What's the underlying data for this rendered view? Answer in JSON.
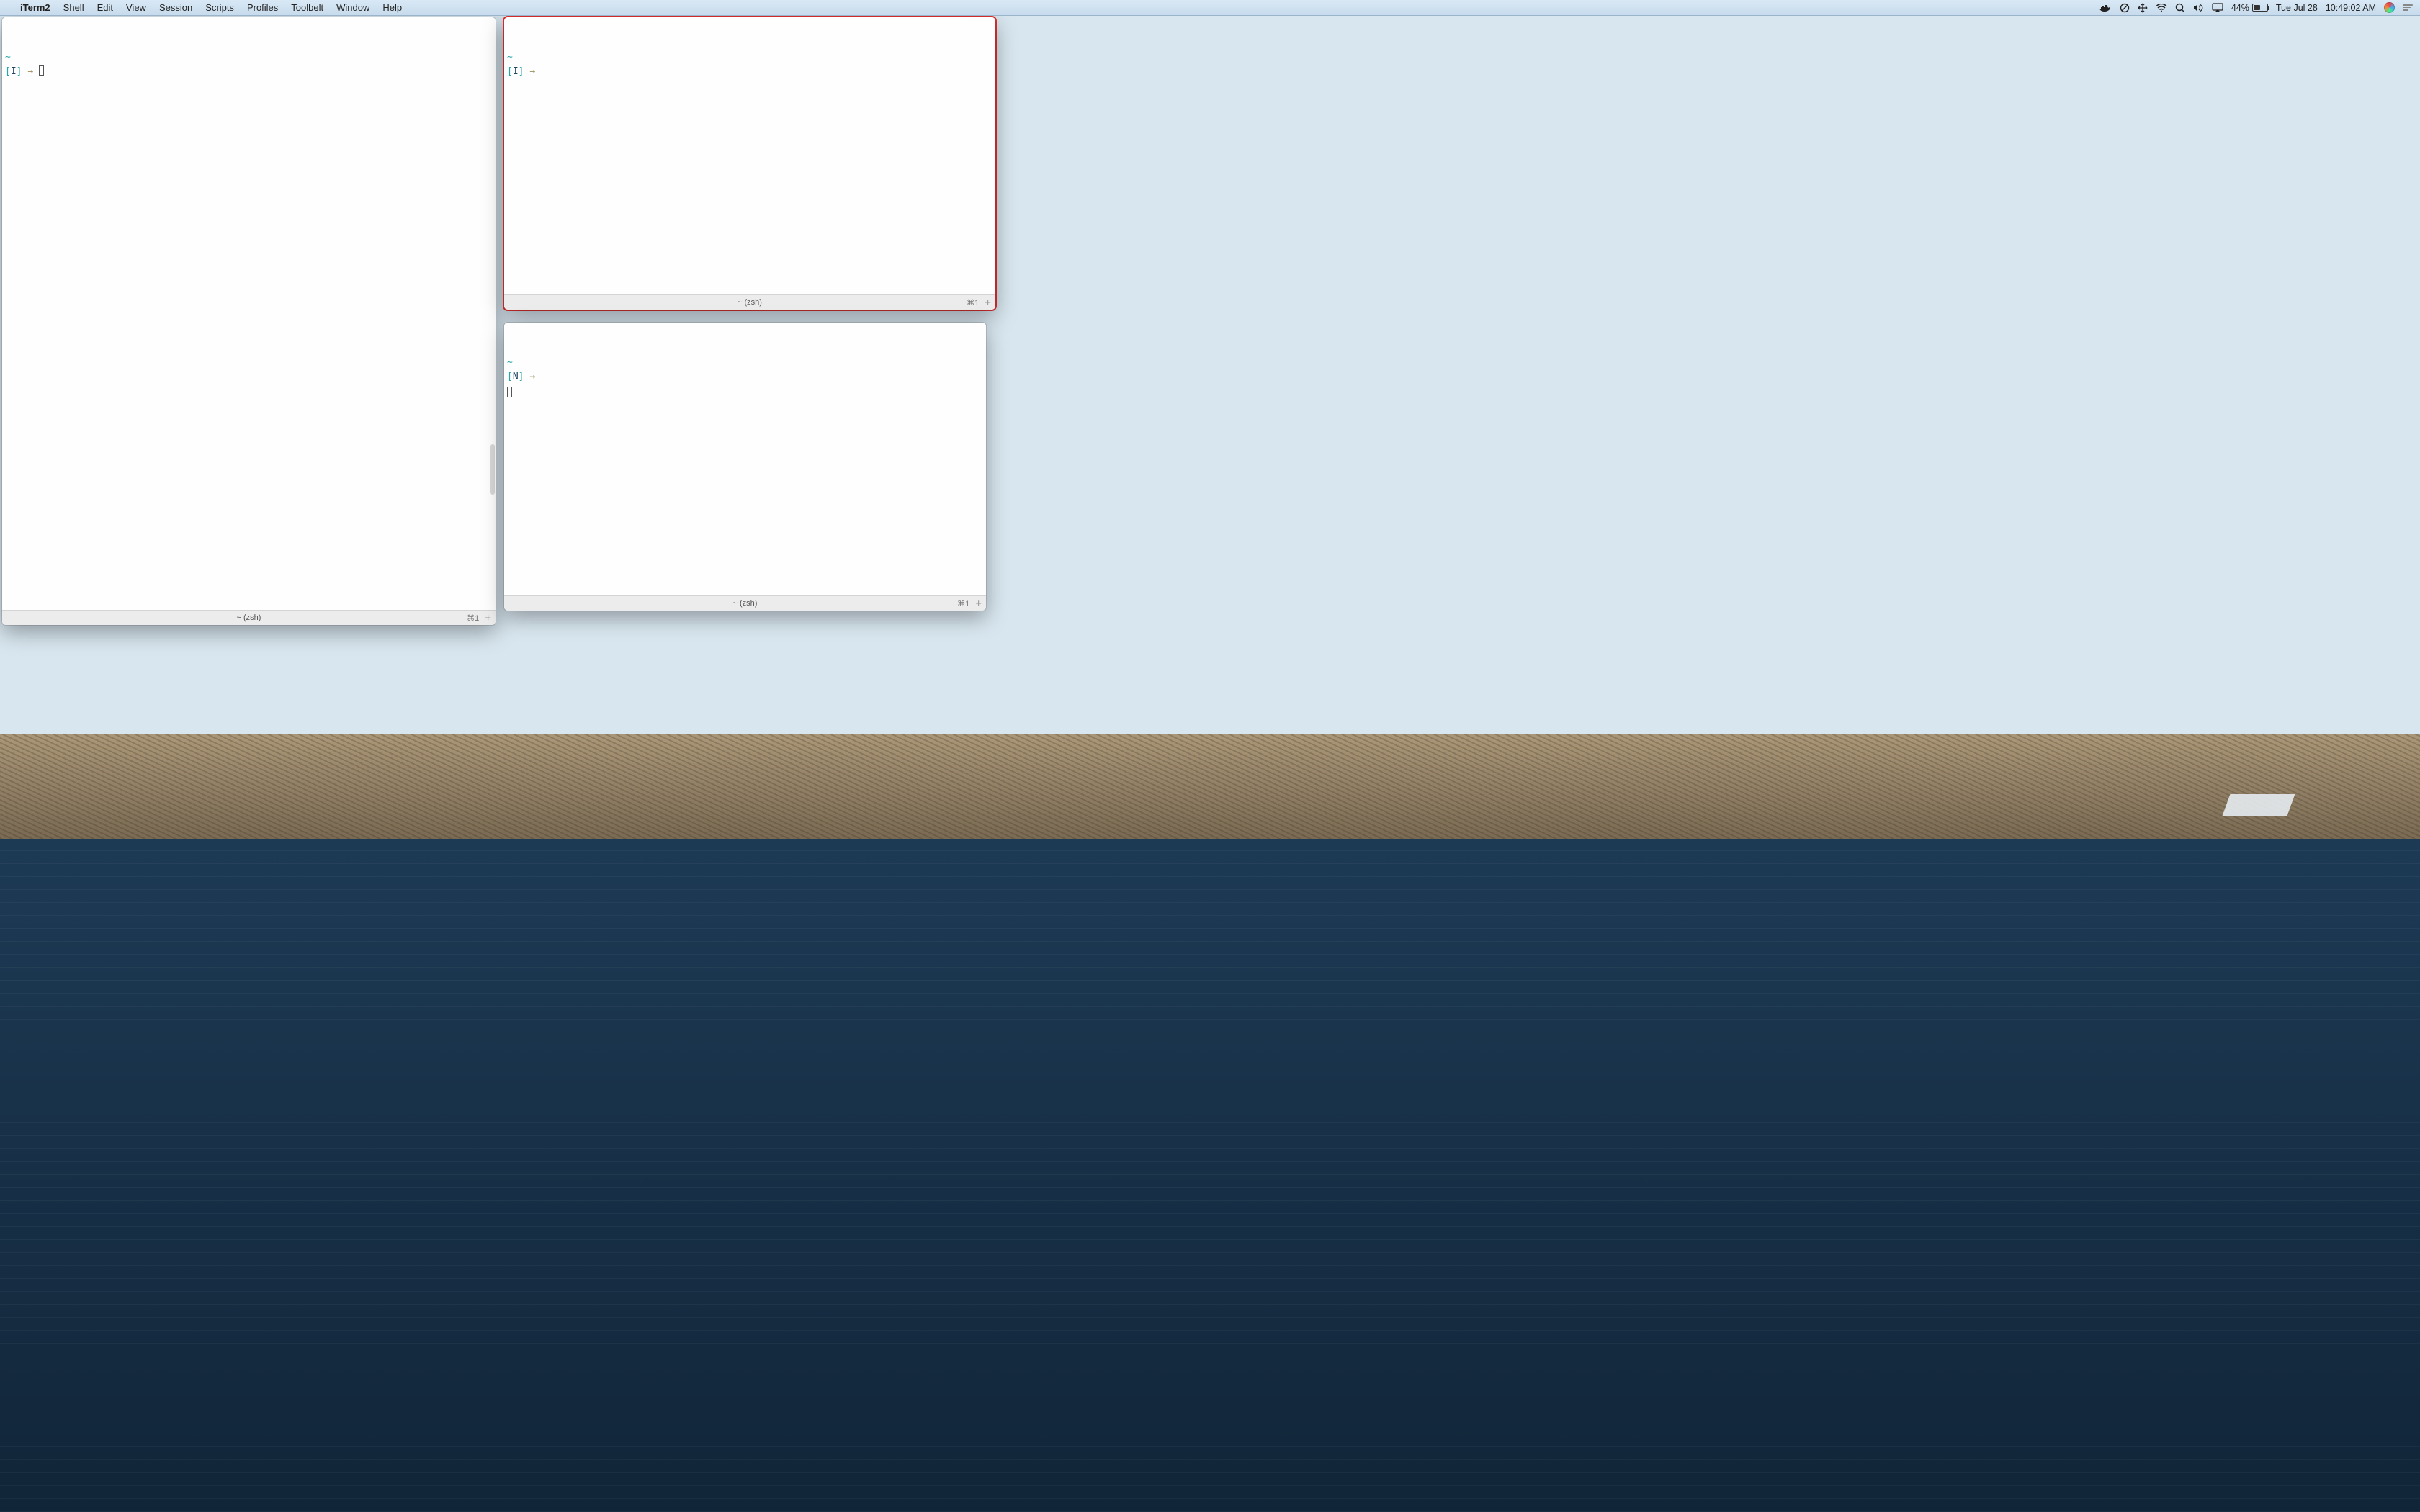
{
  "menubar": {
    "app_name": "iTerm2",
    "items": [
      "Shell",
      "Edit",
      "View",
      "Session",
      "Scripts",
      "Profiles",
      "Toolbelt",
      "Window",
      "Help"
    ],
    "battery_percent": "44%",
    "date": "Tue Jul 28",
    "time": "10:49:02 AM"
  },
  "panes": {
    "left": {
      "cwd_tilde": "~",
      "mode": "I",
      "arrow": "→",
      "tab_title": "~ (zsh)",
      "tab_shortcut": "⌘1"
    },
    "top_right": {
      "cwd_tilde": "~",
      "mode": "I",
      "arrow": "→",
      "tab_title": "~ (zsh)",
      "tab_shortcut": "⌘1"
    },
    "bottom_right": {
      "cwd_tilde": "~",
      "mode": "N",
      "arrow": "→",
      "tab_title": "~ (zsh)",
      "tab_shortcut": "⌘1"
    }
  }
}
